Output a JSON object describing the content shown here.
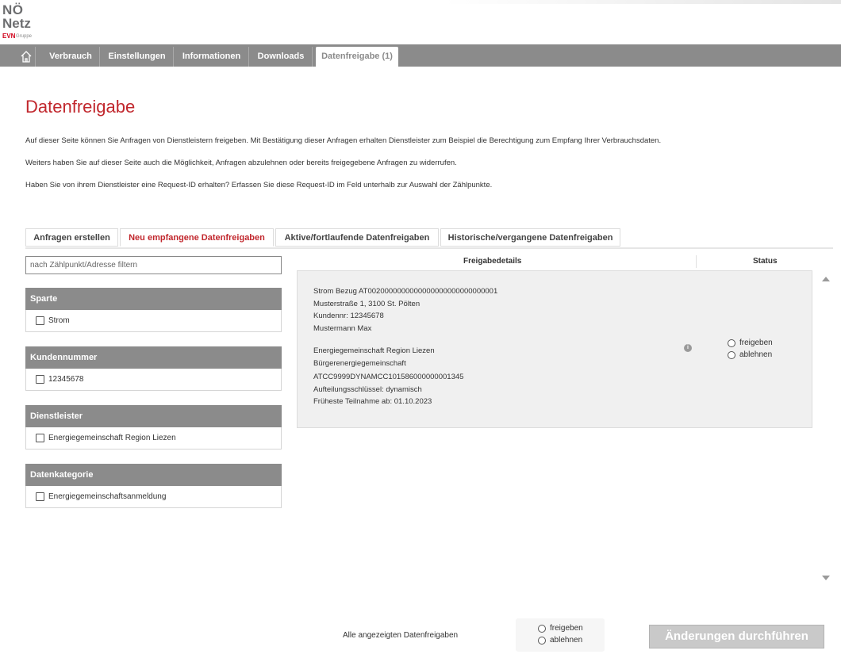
{
  "logo": {
    "line1": "NÖ",
    "line2": "Netz",
    "brand": "EVN",
    "sub": "Gruppe"
  },
  "nav": {
    "home_icon": "home-icon",
    "items": [
      "Verbrauch",
      "Einstellungen",
      "Informationen",
      "Downloads",
      "Datenfreigabe (1)"
    ],
    "active_index": 4
  },
  "page": {
    "title": "Datenfreigabe",
    "paragraphs": [
      "Auf dieser Seite können Sie Anfragen von Dienstleistern freigeben. Mit Bestätigung dieser Anfragen erhalten Dienstleister zum Beispiel die Berechtigung zum Empfang Ihrer Verbrauchsdaten.",
      "Weiters haben Sie auf dieser Seite auch die Möglichkeit, Anfragen abzulehnen oder bereits freigegebene Anfragen zu widerrufen.",
      "Haben Sie von ihrem Dienstleister eine Request-ID erhalten? Erfassen Sie diese Request-ID im Feld unterhalb zur Auswahl der Zählpunkte."
    ]
  },
  "tabs": [
    "Anfragen erstellen",
    "Neu empfangene Datenfreigaben",
    "Aktive/fortlaufende Datenfreigaben",
    "Historische/vergangene Datenfreigaben"
  ],
  "active_tab": 1,
  "filter": {
    "placeholder": "nach Zählpunkt/Adresse filtern",
    "groups": [
      {
        "title": "Sparte",
        "option": "Strom"
      },
      {
        "title": "Kundennummer",
        "option": "12345678"
      },
      {
        "title": "Dienstleister",
        "option": "Energiegemeinschaft Region Liezen"
      },
      {
        "title": "Datenkategorie",
        "option": "Energiegemeinschaftsanmeldung"
      }
    ]
  },
  "details": {
    "col_details": "Freigabedetails",
    "col_status": "Status",
    "lines": [
      "Strom Bezug AT0020000000000000000000000000001",
      "Musterstraße 1, 3100 St. Pölten",
      "Kundennr: 12345678",
      "Mustermann Max",
      "Energiegemeinschaft Region Liezen",
      "Bürgerenergiegemeinschaft",
      "ATCC9999DYNAMCC101586000000001345",
      "Aufteilungsschlüssel: dynamisch",
      "Früheste Teilnahme ab: 01.10.2023"
    ],
    "info_icon": "info-icon",
    "status_options": [
      "freigeben",
      "ablehnen"
    ]
  },
  "footer": {
    "label": "Alle angezeigten Datenfreigaben",
    "options": [
      "freigeben",
      "ablehnen"
    ],
    "apply_button": "Änderungen durchführen"
  },
  "colors": {
    "accent": "#c1272d",
    "nav": "#8b8b8b",
    "button_disabled": "#c9c9c9"
  }
}
